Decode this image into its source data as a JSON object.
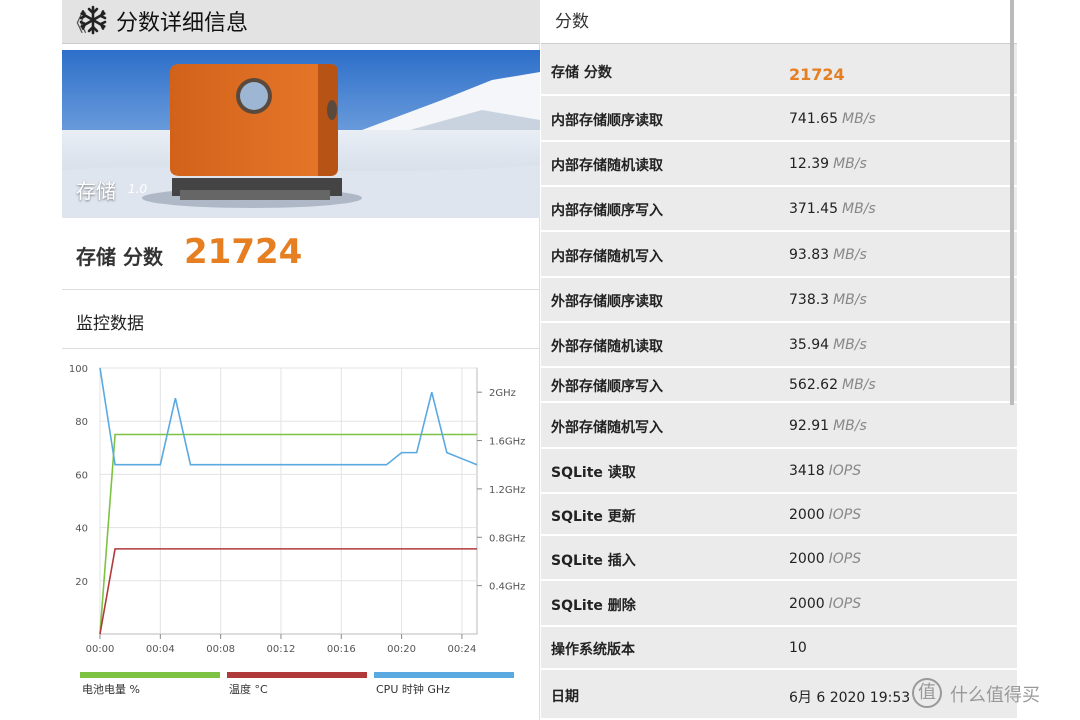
{
  "header": {
    "back_symbol": "《",
    "title": "分数详细信息"
  },
  "banner": {
    "label": "存储",
    "version": "1.0"
  },
  "score": {
    "label": "存储 分数",
    "value": "21724"
  },
  "monitor": {
    "label": "监控数据"
  },
  "right": {
    "header": "分数",
    "rows": [
      {
        "name": "存储 分数",
        "value": "21724",
        "unit": ""
      },
      {
        "name": "内部存储顺序读取",
        "value": "741.65",
        "unit": "MB/s"
      },
      {
        "name": "内部存储随机读取",
        "value": "12.39",
        "unit": "MB/s"
      },
      {
        "name": "内部存储顺序写入",
        "value": "371.45",
        "unit": "MB/s"
      },
      {
        "name": "内部存储随机写入",
        "value": "93.83",
        "unit": "MB/s"
      },
      {
        "name": "外部存储顺序读取",
        "value": "738.3",
        "unit": "MB/s"
      },
      {
        "name": "外部存储随机读取",
        "value": "35.94",
        "unit": "MB/s"
      },
      {
        "name": "外部存储顺序写入",
        "value": "562.62",
        "unit": "MB/s"
      },
      {
        "name": "外部存储随机写入",
        "value": "92.91",
        "unit": "MB/s"
      },
      {
        "name": "SQLite 读取",
        "value": "3418",
        "unit": "IOPS"
      },
      {
        "name": "SQLite 更新",
        "value": "2000",
        "unit": "IOPS"
      },
      {
        "name": "SQLite 插入",
        "value": "2000",
        "unit": "IOPS"
      },
      {
        "name": "SQLite 删除",
        "value": "2000",
        "unit": "IOPS"
      },
      {
        "name": "操作系统版本",
        "value": "10",
        "unit": ""
      },
      {
        "name": "日期",
        "value": "6月 6 2020 19:53",
        "unit": ""
      }
    ]
  },
  "watermark": {
    "symbol": "值",
    "text": "什么值得买"
  },
  "colors": {
    "accent": "#e67e22",
    "battery": "#7dc242",
    "temperature": "#b03a3a",
    "cpu": "#5aa9e0"
  },
  "chart_data": {
    "type": "line",
    "x_ticks": [
      "00:00",
      "00:04",
      "00:08",
      "00:12",
      "00:16",
      "00:20",
      "00:24"
    ],
    "y_left_ticks": [
      "100",
      "80",
      "60",
      "40",
      "20"
    ],
    "y_left_range": [
      0,
      100
    ],
    "y_right_ticks": [
      "2GHz",
      "1.6GHz",
      "1.2GHz",
      "0.8GHz",
      "0.4GHz"
    ],
    "y_right_range": [
      0,
      2.2
    ],
    "x_range_minutes": [
      0,
      25
    ],
    "legend": [
      "电池电量 %",
      "温度 °C",
      "CPU 时钟 GHz"
    ],
    "series": [
      {
        "name": "电池电量 %",
        "axis": "left",
        "x": [
          0,
          1,
          25
        ],
        "y": [
          0,
          75,
          75
        ]
      },
      {
        "name": "温度 °C",
        "axis": "left",
        "x": [
          0,
          1,
          25
        ],
        "y": [
          0,
          32,
          32
        ]
      },
      {
        "name": "CPU 时钟 GHz",
        "axis": "right",
        "x": [
          0,
          1,
          4,
          5,
          6,
          10,
          19,
          20,
          21,
          22,
          23,
          24,
          25
        ],
        "y": [
          2.2,
          1.4,
          1.4,
          1.95,
          1.4,
          1.4,
          1.4,
          1.5,
          1.5,
          2.0,
          1.5,
          1.45,
          1.4
        ]
      }
    ]
  }
}
